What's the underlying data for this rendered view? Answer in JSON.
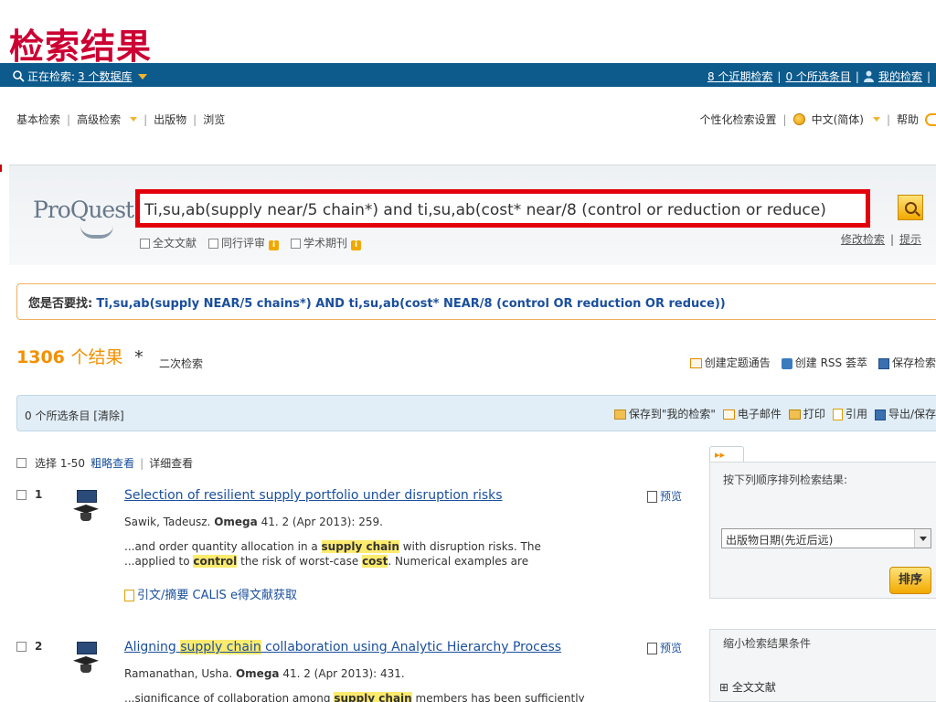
{
  "slide_title": "检索结果",
  "topbar": {
    "searching_label": "正在检索:",
    "databases_link": "3 个数据库",
    "recent_searches": "8 个近期检索",
    "selected_items": "0 个所选条目",
    "my_search": "我的检索",
    "separator": "|"
  },
  "nav": {
    "basic": "基本检索",
    "advanced": "高级检索",
    "publications": "出版物",
    "browse": "浏览",
    "preferences": "个性化检索设置",
    "language": "中文(简体)",
    "help": "帮助",
    "separator": "|"
  },
  "search": {
    "logo": "ProQuest",
    "query": "Ti,su,ab(supply near/5 chain*) and ti,su,ab(cost* near/8 (control or reduction or reduce)",
    "opt_fulltext": "全文文献",
    "opt_peer": "同行评审",
    "opt_scholarly": "学术期刊",
    "modify": "修改检索",
    "tips": "提示",
    "separator": "|",
    "info_badge": "i"
  },
  "did_you_mean": {
    "label": "您是否要找:",
    "suggestion": "Ti,su,ab(supply NEAR/5 chains*) AND ti,su,ab(cost* NEAR/8 (control OR reduction OR reduce))"
  },
  "results": {
    "count": "1306",
    "unit": "个结果",
    "star": "*",
    "refine": "二次检索",
    "create_alert": "创建定题通告",
    "create_rss": "创建 RSS 荟萃",
    "save_search": "保存检索"
  },
  "selection_bar": {
    "selected": "0 个所选条目",
    "clear": "[清除]",
    "save_to_my": "保存到\"我的检索\"",
    "email": "电子邮件",
    "print": "打印",
    "cite": "引用",
    "export": "导出/保存"
  },
  "view": {
    "select_range": "选择 1-50",
    "brief": "粗略查看",
    "detailed": "详细查看",
    "separator": "|"
  },
  "result_items": [
    {
      "num": "1",
      "title": "Selection of resilient supply portfolio under disruption risks",
      "preview": "预览",
      "author": "Sawik, Tadeusz.",
      "journal": "Omega",
      "details": "41. 2 (Apr 2013): 259.",
      "snippet1_a": "...and order quantity allocation in a ",
      "snippet1_hl": "supply chain",
      "snippet1_b": " with disruption risks. The",
      "snippet2_a": "...applied to ",
      "snippet2_hl1": "control",
      "snippet2_b": " the risk of worst-case ",
      "snippet2_hl2": "cost",
      "snippet2_c": ". Numerical examples are",
      "links": "引文/摘要   CALIS e得文献获取"
    },
    {
      "num": "2",
      "title_a": "Aligning ",
      "title_hl": "supply chain",
      "title_b": " collaboration using Analytic Hierarchy Process",
      "preview": "预览",
      "author": "Ramanathan, Usha.",
      "journal": "Omega",
      "details": "41. 2 (Apr 2013): 431.",
      "snippet1_a": "...significance of collaboration among ",
      "snippet1_hl": "supply chain",
      "snippet1_b": " members has been sufficiently"
    }
  ],
  "side": {
    "tab": "▸▸",
    "sort_header": "按下列顺序排列检索结果:",
    "sort_option": "出版物日期(先近后远)",
    "sort_button": "排序",
    "narrow_header": "缩小检索结果条件",
    "narrow_item": "⊞ 全文文献"
  },
  "colors": {
    "topbar": "#0d5a8c",
    "accent": "#f29000",
    "link": "#1a4f9c",
    "highlight_box": "#e3000b",
    "title": "#cc0033"
  }
}
